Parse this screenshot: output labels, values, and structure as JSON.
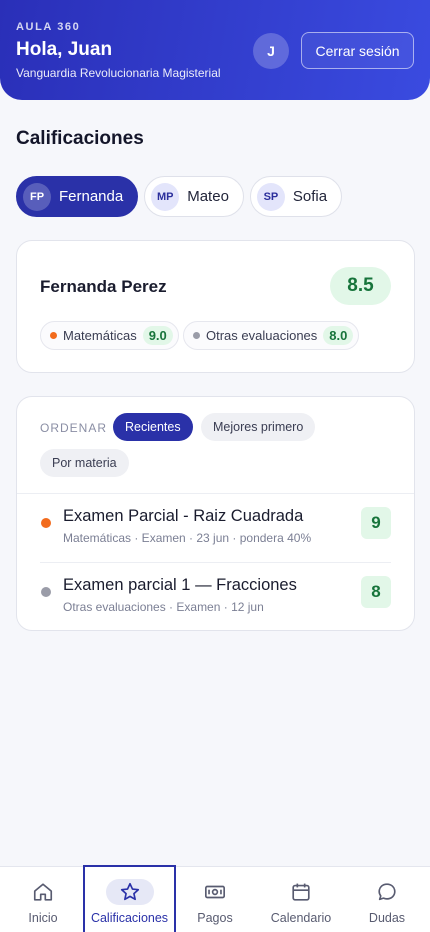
{
  "header": {
    "brand": "AULA 360",
    "greeting": "Hola, Juan",
    "organization": "Vanguardia Revolucionaria Magisterial",
    "avatar_initial": "J",
    "logout_label": "Cerrar sesión",
    "gradient_start": "#2a2fb8",
    "gradient_end": "#3a4be0"
  },
  "section_title": "Calificaciones",
  "students": [
    {
      "initials": "FP",
      "name": "Fernanda",
      "selected": true
    },
    {
      "initials": "MP",
      "name": "Mateo",
      "selected": false
    },
    {
      "initials": "SP",
      "name": "Sofia",
      "selected": false
    }
  ],
  "summary": {
    "student_name": "Fernanda Perez",
    "average": "8.5",
    "subjects": [
      {
        "name": "Matemáticas",
        "score": "9.0",
        "color": "#f26b1d"
      },
      {
        "name": "Otras evaluaciones",
        "score": "8.0",
        "color": "#9a9ca8"
      }
    ]
  },
  "sort": {
    "label": "ORDENAR",
    "options": [
      "Recientes",
      "Mejores primero",
      "Por materia"
    ],
    "selected": "Recientes"
  },
  "grades": [
    {
      "title": "Examen Parcial - Raiz Cuadrada",
      "meta": "Matemáticas · Examen · 23 jun · pondera 40%",
      "score": "9",
      "color": "#f26b1d"
    },
    {
      "title": "Examen parcial 1 — Fracciones",
      "meta": "Otras evaluaciones · Examen · 12 jun",
      "score": "8",
      "color": "#9a9ca8"
    }
  ],
  "nav": {
    "items": [
      {
        "label": "Inicio",
        "icon": "home-icon"
      },
      {
        "label": "Calificaciones",
        "icon": "star-icon"
      },
      {
        "label": "Pagos",
        "icon": "cash-icon"
      },
      {
        "label": "Calendario",
        "icon": "calendar-icon"
      },
      {
        "label": "Dudas",
        "icon": "chat-bubble-icon"
      }
    ],
    "active": "Calificaciones"
  },
  "colors": {
    "accent": "#2a31a8",
    "score_bg": "#e2f7e8",
    "score_text": "#17743b"
  }
}
